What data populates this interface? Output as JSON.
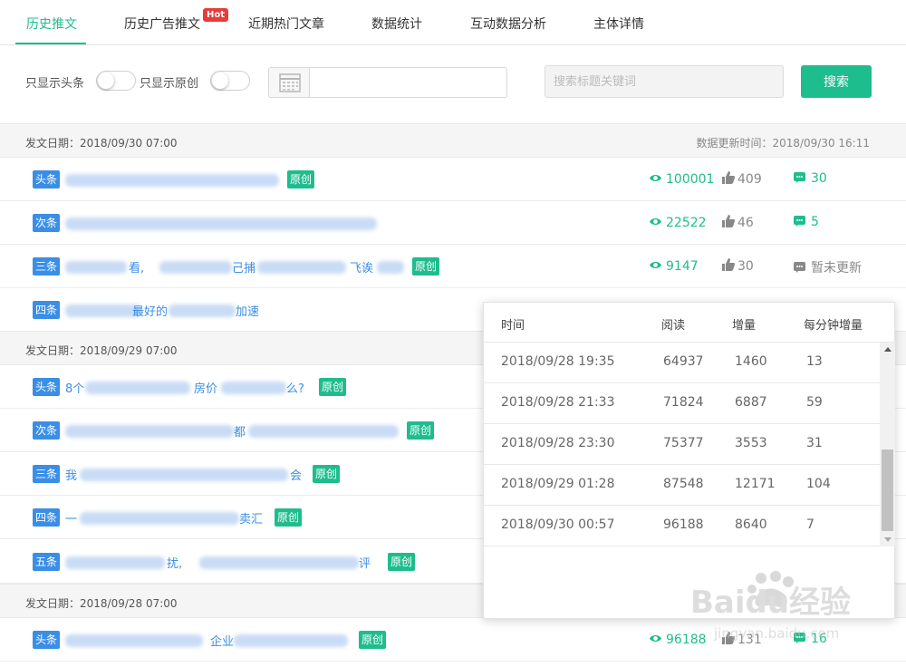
{
  "tabs": [
    {
      "label": "历史推文",
      "active": true
    },
    {
      "label": "历史广告推文",
      "badge": "Hot"
    },
    {
      "label": "近期热门文章"
    },
    {
      "label": "数据统计"
    },
    {
      "label": "互动数据分析"
    },
    {
      "label": "主体详情"
    }
  ],
  "filter": {
    "only_headline_label": "只显示头条",
    "only_original_label": "只显示原创",
    "date_value": "",
    "search_placeholder": "搜索标题关键词",
    "search_button": "搜索"
  },
  "groups": [
    {
      "date_label": "发文日期：2018/09/30 07:00",
      "update_label": "数据更新时间：2018/09/30 16:11",
      "rows": [
        {
          "badge": "头条",
          "title_parts": [
            "",
            ""
          ],
          "original": "原创",
          "reads": "100001",
          "likes": "409",
          "comments": "30"
        },
        {
          "badge": "次条",
          "title_parts": [
            "",
            ""
          ],
          "reads": "22522",
          "likes": "46",
          "comments": "5"
        },
        {
          "badge": "三条",
          "title_parts": [
            "看,",
            "己捕",
            "飞诶"
          ],
          "original": "原创",
          "reads": "9147",
          "likes": "30",
          "comments": "暂未更新"
        },
        {
          "badge": "四条",
          "title_parts": [
            "最好的",
            "加速"
          ]
        }
      ]
    },
    {
      "date_label": "发文日期：2018/09/29 07:00",
      "rows": [
        {
          "badge": "头条",
          "title_parts": [
            "8个",
            "房价",
            "么?"
          ],
          "original": "原创"
        },
        {
          "badge": "次条",
          "title_parts": [
            "都"
          ],
          "original": "原创"
        },
        {
          "badge": "三条",
          "title_parts": [
            "我",
            "会"
          ],
          "original": "原创"
        },
        {
          "badge": "四条",
          "title_parts": [
            "一",
            "卖汇"
          ],
          "original": "原创"
        },
        {
          "badge": "五条",
          "title_parts": [
            "扰,",
            "评"
          ],
          "original": "原创"
        }
      ]
    },
    {
      "date_label": "发文日期：2018/09/28 07:00",
      "rows": [
        {
          "badge": "头条",
          "title_parts": [
            "企业"
          ],
          "original": "原创",
          "reads": "96188",
          "likes": "131",
          "comments": "16"
        }
      ]
    }
  ],
  "popup": {
    "headers": {
      "time": "时间",
      "reads": "阅读",
      "increase": "增量",
      "per_minute": "每分钟增量"
    },
    "rows": [
      {
        "time": "2018/09/28 19:35",
        "reads": "64937",
        "increase": "1460",
        "per_minute": "13"
      },
      {
        "time": "2018/09/28 21:33",
        "reads": "71824",
        "increase": "6887",
        "per_minute": "59"
      },
      {
        "time": "2018/09/28 23:30",
        "reads": "75377",
        "increase": "3553",
        "per_minute": "31"
      },
      {
        "time": "2018/09/29 01:28",
        "reads": "87548",
        "increase": "12171",
        "per_minute": "104"
      },
      {
        "time": "2018/09/30 00:57",
        "reads": "96188",
        "increase": "8640",
        "per_minute": "7"
      }
    ]
  },
  "watermark": {
    "text": "Baidu经验",
    "sub": "jingyan.baidu.com"
  },
  "colors": {
    "accent": "#1ebd8d",
    "link": "#3a8ee6",
    "hot": "#e83b3b"
  }
}
